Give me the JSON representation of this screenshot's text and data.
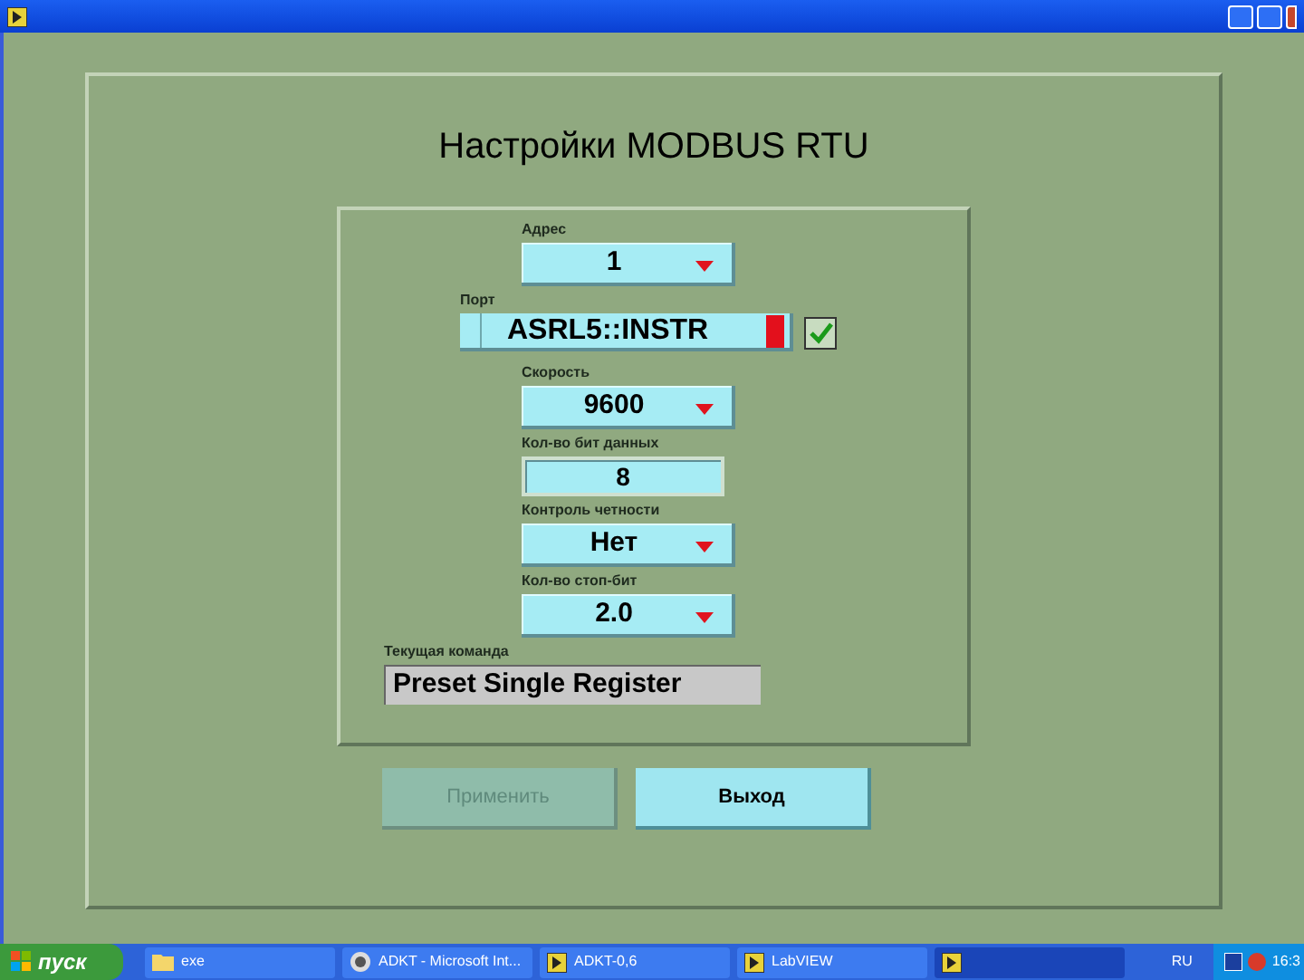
{
  "title": "Настройки MODBUS RTU",
  "fields": [
    {
      "kind": "dropdown",
      "label": "Адрес",
      "value": "1"
    },
    {
      "kind": "resource",
      "label": "Порт",
      "value": "ASRL5::INSTR",
      "checked": true
    },
    {
      "kind": "dropdown",
      "label": "Скорость",
      "value": "9600"
    },
    {
      "kind": "numeric",
      "label": "Кол-во бит данных",
      "value": "8"
    },
    {
      "kind": "dropdown",
      "label": "Контроль четности",
      "value": "Нет"
    },
    {
      "kind": "dropdown",
      "label": "Кол-во стоп-бит",
      "value": "2.0"
    }
  ],
  "current_command": {
    "label": "Текущая команда",
    "value": "Preset Single Register"
  },
  "buttons": [
    {
      "label": "Применить",
      "disabled": true
    },
    {
      "label": "Выход",
      "disabled": false
    }
  ],
  "taskbar": {
    "start": "пуск",
    "items": [
      {
        "label": "exe",
        "kind": "folder",
        "selected": false
      },
      {
        "label": "ADKT - Microsoft Int...",
        "kind": "browser",
        "selected": false
      },
      {
        "label": "ADKT-0,6",
        "kind": "labview",
        "selected": false
      },
      {
        "label": "LabVIEW",
        "kind": "labview",
        "selected": false
      },
      {
        "kind": "labview",
        "selected": true
      }
    ],
    "language": "RU",
    "clock": "16:3"
  }
}
